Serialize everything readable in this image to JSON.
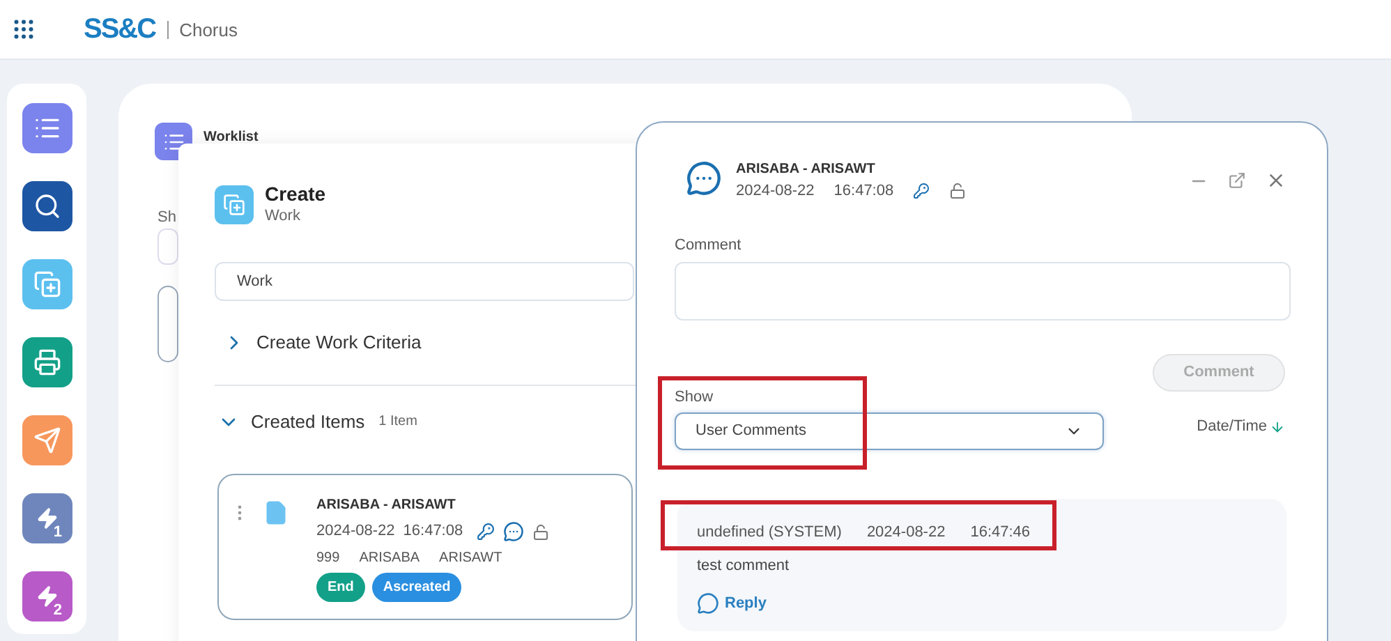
{
  "header": {
    "logo": "SS&C",
    "product": "Chorus"
  },
  "sidebar": {
    "items": [
      {
        "kind": "list",
        "color": "#7b83ec"
      },
      {
        "kind": "search",
        "color": "#1d56a3"
      },
      {
        "kind": "create",
        "color": "#5cc0ef"
      },
      {
        "kind": "fax",
        "color": "#13a088"
      },
      {
        "kind": "send",
        "color": "#f7975c"
      },
      {
        "kind": "bolt",
        "color": "#6f86bd",
        "badge": "1"
      },
      {
        "kind": "bolt",
        "color": "#b85ac8",
        "badge": "2"
      }
    ]
  },
  "worklist": {
    "title": "Worklist",
    "show_label": "Sh"
  },
  "create": {
    "title": "Create",
    "subtitle": "Work",
    "field_value": "Work",
    "sections": [
      {
        "label": "Create Work Criteria",
        "expanded": false
      },
      {
        "label": "Created Items",
        "count": "1 Item",
        "expanded": true
      }
    ],
    "item": {
      "title": "ARISABA - ARISAWT",
      "date": "2024-08-22",
      "time": "16:47:08",
      "fields": [
        "999",
        "ARISABA",
        "ARISAWT"
      ],
      "tags": [
        {
          "label": "End",
          "color": "#12a089"
        },
        {
          "label": "Ascreated",
          "color": "#2a8fe0"
        }
      ]
    }
  },
  "comments": {
    "title": "ARISABA - ARISAWT",
    "date": "2024-08-22",
    "time": "16:47:08",
    "comment_label": "Comment",
    "comment_button": {
      "label": "Comment",
      "disabled": true
    },
    "show_label": "Show",
    "show_value": "User Comments",
    "sort_label": "Date/Time",
    "entries": [
      {
        "author": "undefined (SYSTEM)",
        "date": "2024-08-22",
        "time": "16:47:46",
        "text": "test comment",
        "reply": "Reply"
      }
    ]
  }
}
